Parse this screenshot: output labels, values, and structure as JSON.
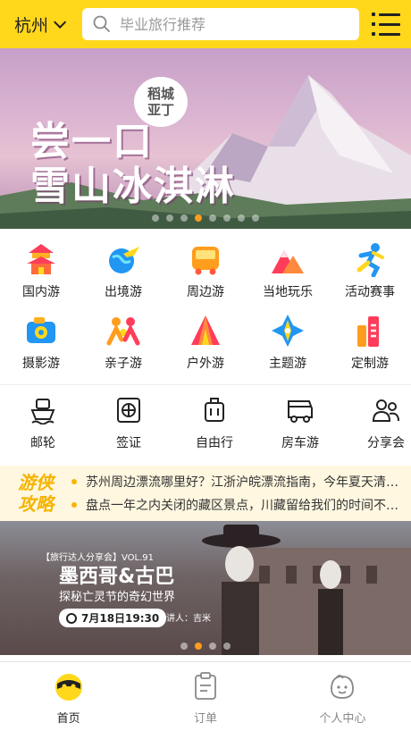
{
  "header": {
    "city": "杭州",
    "search_placeholder": "毕业旅行推荐"
  },
  "banner": {
    "line1": "尝一口",
    "line2": "雪山冰淇淋",
    "badge_line1": "稻城",
    "badge_line2": "亚丁",
    "slide_count": 8,
    "active_slide": 4
  },
  "categories": [
    {
      "label": "国内游",
      "icon": "pagoda-icon"
    },
    {
      "label": "出境游",
      "icon": "globe-plane-icon"
    },
    {
      "label": "周边游",
      "icon": "bus-icon"
    },
    {
      "label": "当地玩乐",
      "icon": "mountain-icon"
    },
    {
      "label": "活动赛事",
      "icon": "runner-icon"
    },
    {
      "label": "摄影游",
      "icon": "camera-icon"
    },
    {
      "label": "亲子游",
      "icon": "family-icon"
    },
    {
      "label": "户外游",
      "icon": "tent-icon"
    },
    {
      "label": "主题游",
      "icon": "compass-icon"
    },
    {
      "label": "定制游",
      "icon": "custom-bars-icon"
    }
  ],
  "services": [
    {
      "label": "邮轮",
      "icon": "ship-icon"
    },
    {
      "label": "签证",
      "icon": "visa-icon"
    },
    {
      "label": "自由行",
      "icon": "luggage-icon"
    },
    {
      "label": "房车游",
      "icon": "rv-icon"
    },
    {
      "label": "分享会",
      "icon": "share-people-icon"
    }
  ],
  "news": {
    "logo_line1": "游侠",
    "logo_line2": "攻略",
    "items": [
      "苏州周边漂流哪里好？江浙沪皖漂流指南，今年夏天清凉一夏",
      "盘点一年之内关闭的藏区景点，川藏留给我们的时间不多了"
    ]
  },
  "promo": {
    "tag": "【旅行达人分享会】VOL.91",
    "title": "墨西哥&古巴",
    "subtitle": "探秘亡灵节的奇幻世界",
    "date": "7月18日19:30",
    "speaker": "主讲人：吉米",
    "slide_count": 4,
    "active_slide": 2
  },
  "tabbar": [
    {
      "label": "首页",
      "icon": "home-mascot-icon",
      "active": true
    },
    {
      "label": "订单",
      "icon": "order-icon",
      "active": false
    },
    {
      "label": "个人中心",
      "icon": "profile-icon",
      "active": false
    }
  ],
  "colors": {
    "brand_yellow": "#ffd81c",
    "accent_orange": "#ff9d1c"
  }
}
